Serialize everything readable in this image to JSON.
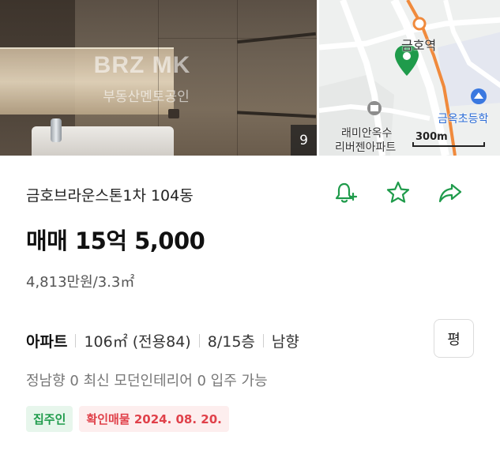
{
  "media": {
    "watermark_logo": "BRZ MK",
    "watermark_text": "부동산멘토공인",
    "photo_count": "9"
  },
  "map": {
    "station_label": "금호역",
    "apartment_label_line1": "래미안옥수",
    "apartment_label_line2": "리버젠아파트",
    "school_label": "금옥초등학",
    "scale_label": "300m",
    "pin_color": "#1f9b4b",
    "subway_line_color": "#f08a3c"
  },
  "listing": {
    "title": "금호브라운스톤1차 104동",
    "price": "매매 15억 5,000",
    "unit_price": "4,813만원/3.3㎡",
    "specs": {
      "type": "아파트",
      "area": "106㎡ (전용84)",
      "floor": "8/15층",
      "direction": "남향"
    },
    "pyeong_button_label": "평",
    "description": "정남향 0 최신 모던인테리어 0 입주 가능",
    "tags": {
      "owner": "집주인",
      "verified": "확인매물 2024. 08. 20."
    }
  },
  "actions": {
    "alert_icon": "bell-plus-icon",
    "favorite_icon": "star-icon",
    "share_icon": "share-arrow-icon",
    "icon_color": "#1f9b4b"
  }
}
